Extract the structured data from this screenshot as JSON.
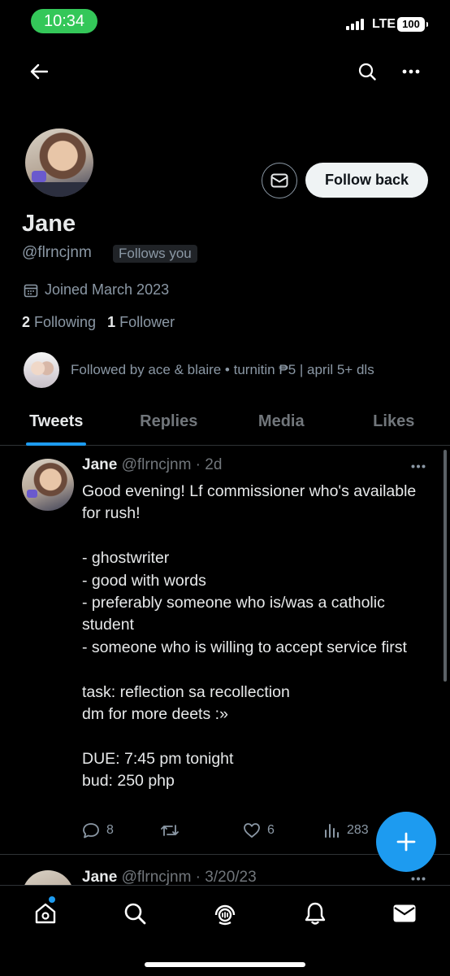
{
  "status_bar": {
    "time": "10:34",
    "network": "LTE",
    "battery": "100"
  },
  "nav": {
    "back_icon": "arrow-left-icon",
    "search_icon": "search-icon",
    "more_icon": "more-icon"
  },
  "profile": {
    "display_name": "Jane",
    "handle": "@flrncjnm",
    "follows_you": "Follows you",
    "joined": "Joined March 2023",
    "following_count": "2",
    "following_label": "Following",
    "follower_count": "1",
    "follower_label": "Follower",
    "followed_by": "Followed by ace & blaire • turnitin ₱5 | april 5+ dls",
    "follow_button": "Follow back"
  },
  "tabs": [
    {
      "label": "Tweets",
      "active": true
    },
    {
      "label": "Replies",
      "active": false
    },
    {
      "label": "Media",
      "active": false
    },
    {
      "label": "Likes",
      "active": false
    }
  ],
  "tweets": [
    {
      "name": "Jane",
      "meta": "@flrncjnm · 2d",
      "text": "Good evening! Lf commissioner who's available for rush!\n\n- ghostwriter\n- good with words\n- preferably someone who is/was a catholic student\n- someone who is willing to accept service first\n\ntask: reflection sa recollection\ndm for more deets :»\n\nDUE: 7:45 pm tonight\nbud: 250 php",
      "replies": "8",
      "retweets": "",
      "likes": "6",
      "views": "283"
    },
    {
      "name": "Jane",
      "meta": "@flrncjnm · 3/20/23"
    }
  ],
  "colors": {
    "accent": "#1d9bf0",
    "background": "#000000",
    "muted": "#8b98a5",
    "status_green": "#34c759"
  }
}
